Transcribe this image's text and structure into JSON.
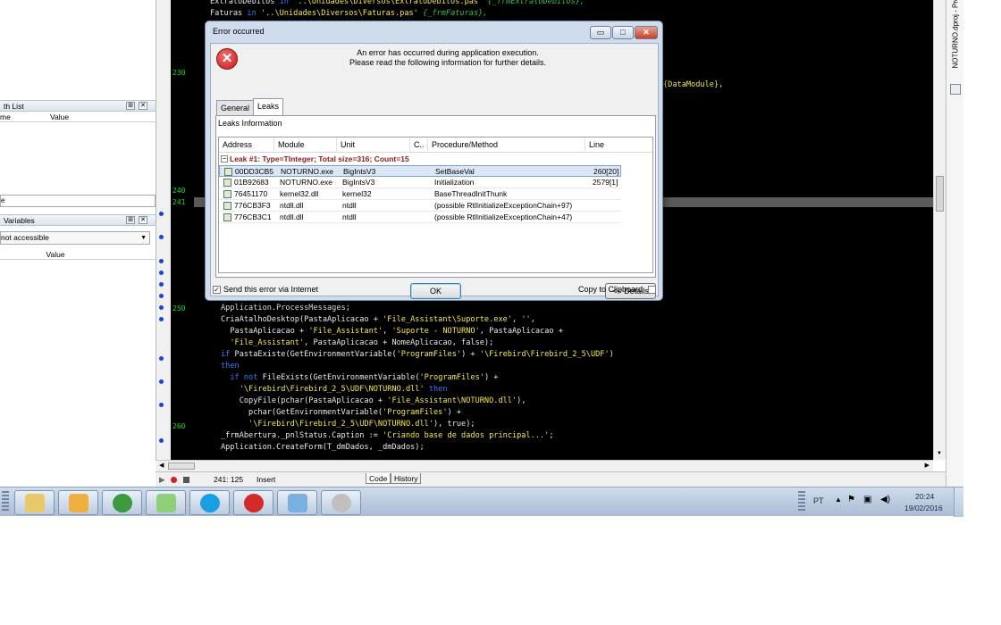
{
  "left_panels": {
    "watch_list": {
      "title": "th List",
      "col_name": "me",
      "col_value": "Value"
    },
    "input_value": "e",
    "local_vars": {
      "title": " Variables",
      "dropdown_value": "not accessible",
      "col_value": "Value"
    }
  },
  "editor": {
    "lines": [
      {
        "ln": "",
        "parts": [
          [
            "",
            "ExtratoDebitos "
          ],
          [
            "kw",
            "in"
          ],
          [
            "st",
            " '..\\Unidades\\Diversos\\ExtratoDebitos.pas'"
          ],
          [
            "cm",
            " {_frmExtratoDebitos},"
          ]
        ]
      },
      {
        "ln": "",
        "parts": [
          [
            "",
            "Faturas "
          ],
          [
            "kw",
            "in"
          ],
          [
            "st",
            " '..\\Unidades\\Diversos\\Faturas.pas'"
          ],
          [
            "cm",
            " {_frmFaturas},"
          ]
        ]
      }
    ],
    "line_230": "230",
    "datamodule_fragment": "{DataModule},",
    "line_240": "240",
    "line_241": "241",
    "line_250": "250",
    "line_260": "260",
    "lower_lines": [
      {
        "parts": [
          [
            "",
            "Application.ProcessMessages;"
          ]
        ]
      },
      {
        "parts": [
          [
            "",
            "CriaAtalhoDesktop(PastaAplicacao + "
          ],
          [
            "st",
            "'File_Assistant\\Suporte.exe'"
          ],
          [
            "",
            ", "
          ],
          [
            "st",
            "''"
          ],
          [
            "",
            ","
          ]
        ]
      },
      {
        "parts": [
          [
            "",
            "  PastaAplicacao + "
          ],
          [
            "st",
            "'File_Assistant'"
          ],
          [
            "",
            ", "
          ],
          [
            "st",
            "'Suporte - NOTURNO'"
          ],
          [
            "",
            ", PastaAplicacao +"
          ]
        ]
      },
      {
        "parts": [
          [
            "st",
            "  'File_Assistant'"
          ],
          [
            "",
            ", PastaAplicacao + NomeAplicacao, false);"
          ]
        ]
      },
      {
        "parts": [
          [
            "kw",
            "if"
          ],
          [
            "",
            " PastaExiste(GetEnvironmentVariable("
          ],
          [
            "st",
            "'ProgramFiles'"
          ],
          [
            "",
            ") + "
          ],
          [
            "st",
            "'\\Firebird\\Firebird_2_5\\UDF'"
          ],
          [
            "",
            ")"
          ]
        ]
      },
      {
        "parts": [
          [
            "kw",
            "then"
          ]
        ]
      },
      {
        "parts": [
          [
            "kw",
            "  if not"
          ],
          [
            "",
            " FileExists(GetEnvironmentVariable("
          ],
          [
            "st",
            "'ProgramFiles'"
          ],
          [
            "",
            ") +"
          ]
        ]
      },
      {
        "parts": [
          [
            "st",
            "    '\\Firebird\\Firebird_2_5\\UDF\\NOTURNO.dll'"
          ],
          [
            "kw",
            " then"
          ]
        ]
      },
      {
        "parts": [
          [
            "",
            "    CopyFile(pchar(PastaAplicacao + "
          ],
          [
            "st",
            "'File_Assistant\\NOTURNO.dll'"
          ],
          [
            "",
            "),"
          ]
        ]
      },
      {
        "parts": [
          [
            "",
            "      pchar(GetEnvironmentVariable("
          ],
          [
            "st",
            "'ProgramFiles'"
          ],
          [
            "",
            ") +"
          ]
        ]
      },
      {
        "parts": [
          [
            "st",
            "      '\\Firebird\\Firebird_2_5\\UDF\\NOTURNO.dll'"
          ],
          [
            "",
            "), true);"
          ]
        ]
      },
      {
        "parts": [
          [
            "",
            "_frmAbertura._pnlStatus.Caption := "
          ],
          [
            "st",
            "'Criando base de dados principal...'"
          ],
          [
            "",
            ";"
          ]
        ]
      },
      {
        "parts": [
          [
            "",
            "Application.CreateForm(T_dmDados, _dmDados);"
          ]
        ]
      }
    ]
  },
  "status_bar": {
    "position": "241: 125",
    "mode": "Insert",
    "tab_code": "Code",
    "tab_history": "History"
  },
  "right_strip": {
    "label": "NOTURNO.dproj - Pro"
  },
  "dialog": {
    "title": "Error occurred",
    "message_line1": "An error has occurred during application execution.",
    "message_line2": "Please read the following information for further details.",
    "tabs": [
      {
        "label": "General"
      },
      {
        "label": "Leaks"
      }
    ],
    "leaks_info_label": "Leaks Information",
    "columns": {
      "address": "Address",
      "module": "Module",
      "unit": "Unit",
      "c": "C..",
      "procedure": "Procedure/Method",
      "line": "Line"
    },
    "leak_group": "Leak #1: Type=TInteger; Total size=316; Count=15",
    "rows": [
      {
        "address": "00DD3CB5",
        "module": "NOTURNO.exe",
        "unit": "BigIntsV3",
        "procedure": "SetBaseVal",
        "line": "260[20]"
      },
      {
        "address": "01B92683",
        "module": "NOTURNO.exe",
        "unit": "BigIntsV3",
        "procedure": "Initialization",
        "line": "2579[1]"
      },
      {
        "address": "76451170",
        "module": "kernel32.dll",
        "unit": "kernel32",
        "procedure": "BaseThreadInitThunk",
        "line": ""
      },
      {
        "address": "776CB3F3",
        "module": "ntdll.dll",
        "unit": "ntdll",
        "procedure": " (possible RtlInitializeExceptionChain+97)",
        "line": ""
      },
      {
        "address": "776CB3C1",
        "module": "ntdll.dll",
        "unit": "ntdll",
        "procedure": " (possible RtlInitializeExceptionChain+47)",
        "line": ""
      }
    ],
    "ok_label": "OK",
    "details_label": "<< Details",
    "send_label": "Send this error via Internet",
    "clipboard_label": "Copy to Clipboard"
  },
  "taskbar": {
    "language": "PT",
    "time": "20:24",
    "date": "19/02/2016",
    "apps": [
      "file-manager",
      "outlook",
      "chrome",
      "folder",
      "skype",
      "delphi",
      "paint",
      "antivirus"
    ]
  },
  "colors": {
    "editor_bg": "#000000",
    "keyword": "#3a78ff",
    "string": "#f4e84a",
    "comment": "#30c050",
    "line_number": "#22d422",
    "dialog_frame": "#cfdcec",
    "error_red": "#d42020"
  }
}
